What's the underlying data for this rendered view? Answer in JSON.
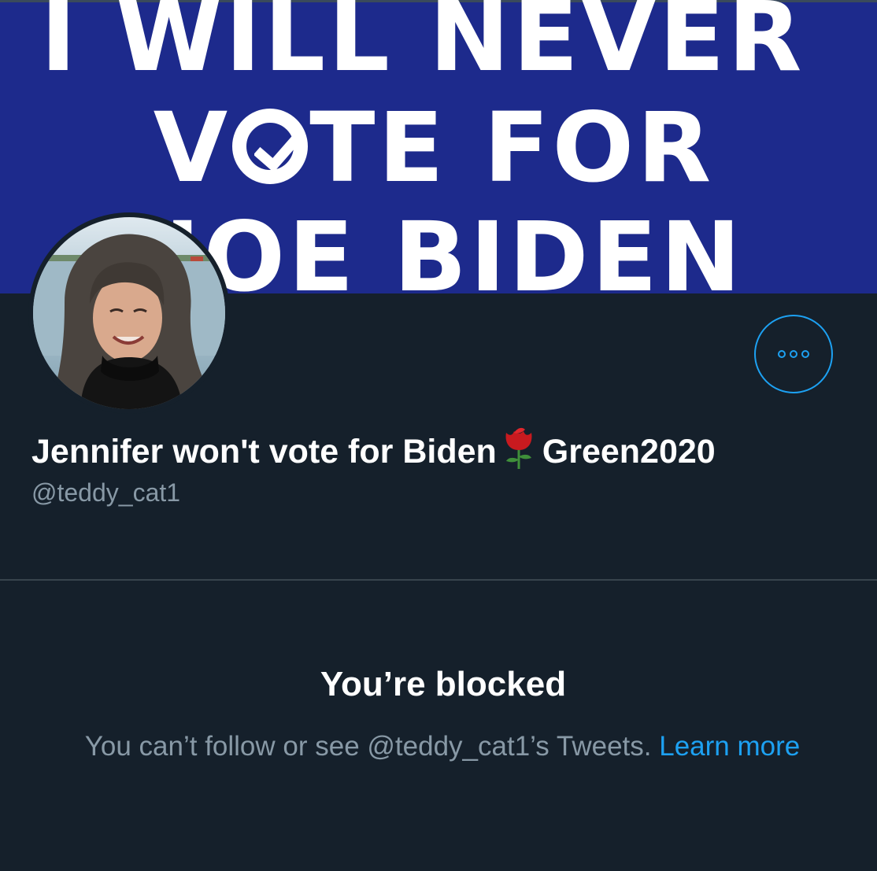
{
  "banner": {
    "line1": "I WILL NEVER",
    "line2_prefix": "V",
    "line2_suffix": "TE FOR",
    "line3": "JOE BIDEN"
  },
  "profile": {
    "display_name_prefix": "Jennifer won't vote for Biden",
    "display_name_suffix": "Green2020",
    "handle": "@teddy_cat1"
  },
  "more_button": {
    "icon": "more-icon"
  },
  "blocked": {
    "title": "You’re blocked",
    "message": "You can’t follow or see @teddy_cat1’s Tweets.",
    "link": "Learn more"
  },
  "colors": {
    "background": "#15202b",
    "banner": "#1d2a8c",
    "accent": "#1da1f2",
    "secondary_text": "#8899a6",
    "divider": "#38444d"
  }
}
